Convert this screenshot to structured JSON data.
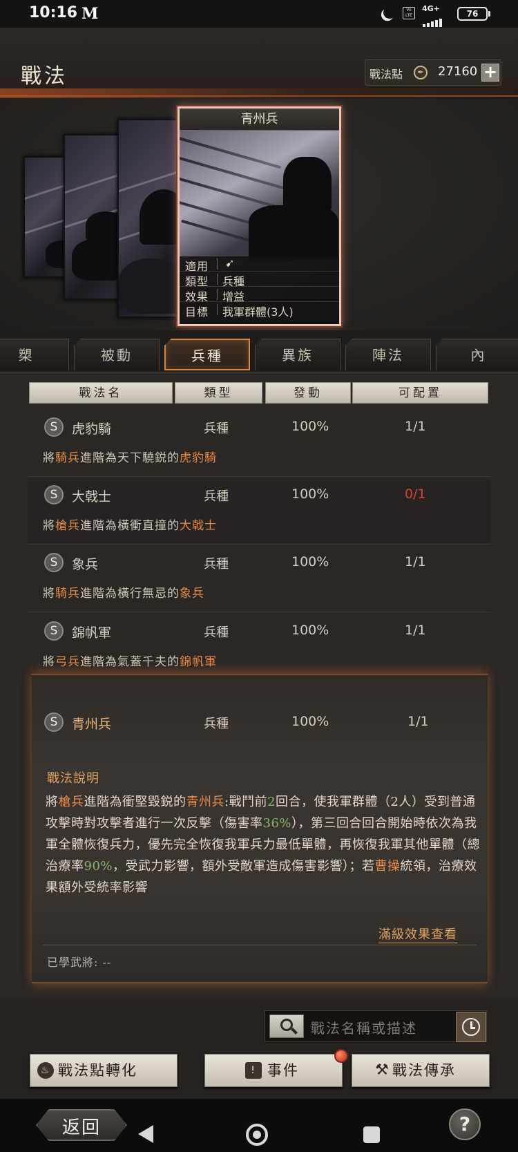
{
  "status": {
    "time": "10:16",
    "carrier_icon": "M",
    "network": "4G+",
    "volte": "Vo LTE",
    "battery": "76"
  },
  "header": {
    "title": "戰法",
    "points_label": "戰法點",
    "points_value": "27160",
    "add": "+"
  },
  "card": {
    "title": "青州兵",
    "info": [
      {
        "key": "適用",
        "value": ""
      },
      {
        "key": "類型",
        "value": "兵種"
      },
      {
        "key": "效果",
        "value": "增益"
      },
      {
        "key": "目標",
        "value": "我軍群體(3人)"
      }
    ]
  },
  "tabs": [
    "槊",
    "被動",
    "兵種",
    "異族",
    "陣法",
    "內"
  ],
  "active_tab": "兵種",
  "table": {
    "headers": [
      "戰法名",
      "類型",
      "發動",
      "可配置"
    ],
    "rows": [
      {
        "grade": "S",
        "name": "虎豹騎",
        "type": "兵種",
        "rate": "100%",
        "slots": "1/1",
        "desc": {
          "pre": "將",
          "hl1": "騎兵",
          "mid": "進階為天下驍鋭的",
          "hl2": "虎豹騎"
        }
      },
      {
        "grade": "S",
        "name": "大戟士",
        "type": "兵種",
        "rate": "100%",
        "slots": "0/1",
        "desc": {
          "pre": "將",
          "hl1": "槍兵",
          "mid": "進階為橫衝直撞的",
          "hl2": "大戟士"
        }
      },
      {
        "grade": "S",
        "name": "象兵",
        "type": "兵種",
        "rate": "100%",
        "slots": "1/1",
        "desc": {
          "pre": "將",
          "hl1": "騎兵",
          "mid": "進階為橫行無忌的",
          "hl2": "象兵"
        }
      },
      {
        "grade": "S",
        "name": "錦帆軍",
        "type": "兵種",
        "rate": "100%",
        "slots": "1/1",
        "desc": {
          "pre": "將",
          "hl1": "弓兵",
          "mid": "進階為氣蓋千夫的",
          "hl2": "錦帆軍"
        }
      }
    ]
  },
  "expanded": {
    "grade": "S",
    "name": "青州兵",
    "type": "兵種",
    "rate": "100%",
    "slots": "1/1",
    "desc_title": "戰法說明",
    "desc": {
      "p1": "將",
      "h1": "槍兵",
      "p2": "進階為衝堅毀鋭的",
      "h2": "青州兵",
      "p3": ":戰鬥前",
      "n1": "2",
      "p4": "回合，使我軍群體（2人）受到普通攻擊時對攻擊者進行一次反擊（傷害率",
      "n2": "36%",
      "p5": "），第三回合回合開始時依次為我軍全體恢復兵力，優先完全恢復我軍兵力最低單體，再恢復我軍其他單體（總治療率",
      "n3": "90%",
      "p6": "，受武力影響，額外受敵軍造成傷害影響）；若",
      "h3": "曹操",
      "p7": "統領，治療效果額外受統率影響"
    },
    "full_effect": "滿級效果查看",
    "learned": "已學武將: --"
  },
  "search": {
    "placeholder": "戰法名稱或描述"
  },
  "buttons": {
    "convert": "戰法點轉化",
    "event": "事件",
    "inherit": "戰法傳承"
  },
  "nav": {
    "back": "返回",
    "help": "?"
  },
  "colors": {
    "highlight": "#e58a46",
    "active_tab_border": "#d68542",
    "warning": "#d54530",
    "number": "#88b56a"
  }
}
